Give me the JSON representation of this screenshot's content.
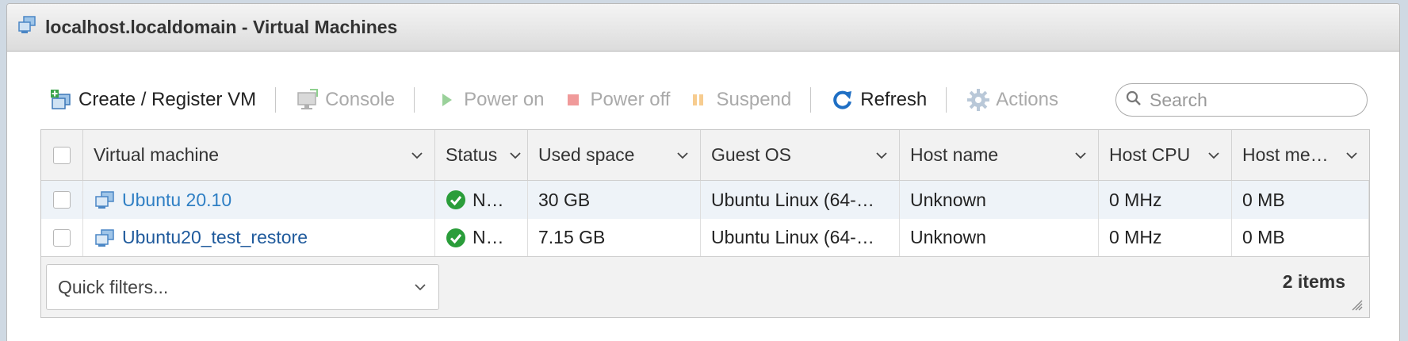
{
  "window": {
    "title": "localhost.localdomain - Virtual Machines"
  },
  "toolbar": {
    "create": "Create / Register VM",
    "console": "Console",
    "power_on": "Power on",
    "power_off": "Power off",
    "suspend": "Suspend",
    "refresh": "Refresh",
    "actions": "Actions",
    "search_placeholder": "Search"
  },
  "table": {
    "columns": [
      "Virtual machine",
      "Status",
      "Used space",
      "Guest OS",
      "Host name",
      "Host CPU",
      "Host me…"
    ],
    "rows": [
      {
        "name": "Ubuntu 20.10",
        "status": "N…",
        "used_space": "30 GB",
        "guest_os": "Ubuntu Linux (64-…",
        "host_name": "Unknown",
        "host_cpu": "0 MHz",
        "host_memory": "0 MB"
      },
      {
        "name": "Ubuntu20_test_restore",
        "status": "N…",
        "used_space": "7.15 GB",
        "guest_os": "Ubuntu Linux (64-…",
        "host_name": "Unknown",
        "host_cpu": "0 MHz",
        "host_memory": "0 MB"
      }
    ]
  },
  "footer": {
    "quick_filters": "Quick filters...",
    "item_count": "2 items"
  },
  "colors": {
    "accent": "#2f7fc4",
    "status_ok": "#2a9d3a",
    "power_off": "#e06666",
    "suspend": "#f4b860"
  }
}
